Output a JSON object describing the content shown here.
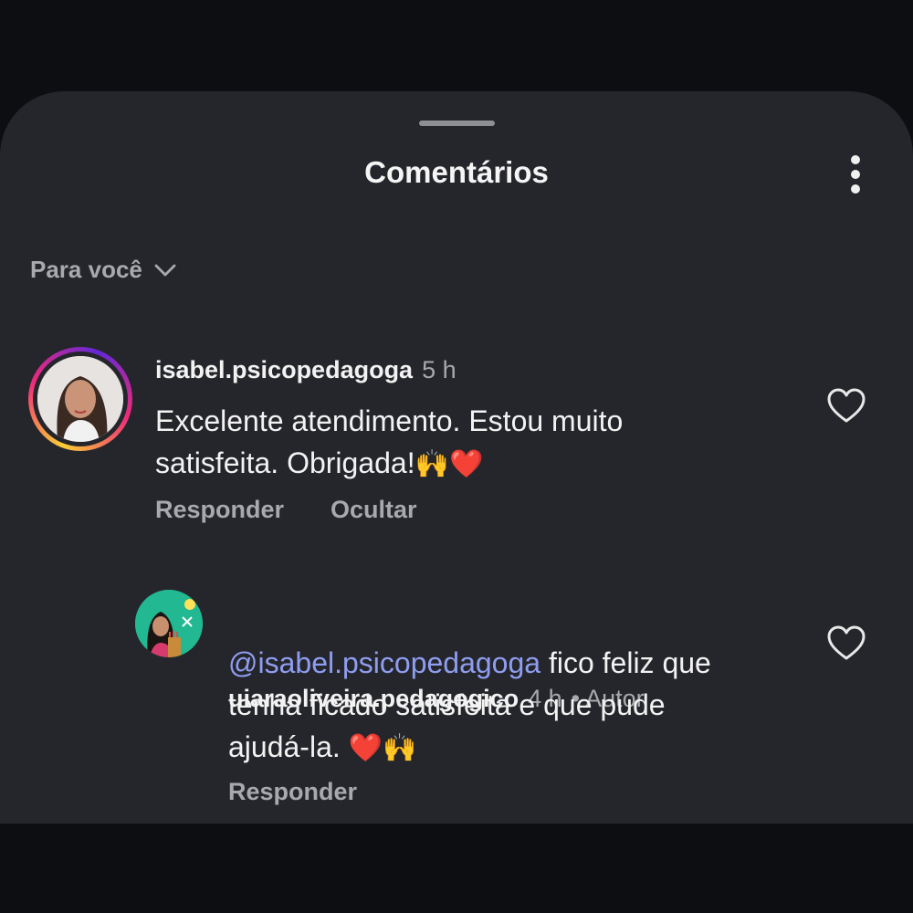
{
  "sheet": {
    "title": "Comentários",
    "filter_label": "Para você"
  },
  "comments": [
    {
      "username": "isabel.psicopedagoga",
      "time": "5 h",
      "text_line1": "Excelente atendimento. Estou muito",
      "text_line2": "satisfeita. Obrigada!",
      "emojis": "🙌❤️",
      "actions": [
        "Responder",
        "Ocultar"
      ]
    },
    {
      "username": "uiaraoliveira.pedagogico",
      "time": "4 h",
      "author_badge": "• Autor",
      "mention": "@isabel.psicopedagoga",
      "text_rest1": " fico feliz que",
      "text_line2": "tenha ficado satisfeita e que pude",
      "text_line3": "ajudá-la.",
      "emojis": "❤️🙌",
      "actions": [
        "Responder"
      ]
    }
  ],
  "icons": {
    "more": "kebab-menu-icon",
    "filter_chevron": "chevron-down-icon",
    "like": "heart-outline-icon"
  },
  "colors": {
    "sheet_background": "#25262b",
    "mention": "#8f9df0",
    "muted_text": "#a8a9ad"
  }
}
